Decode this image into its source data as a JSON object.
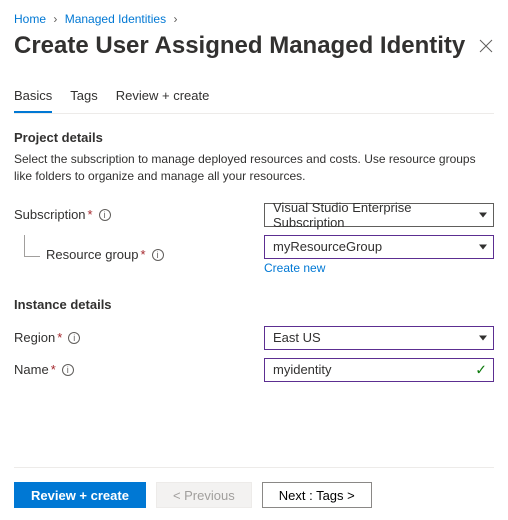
{
  "breadcrumb": {
    "home": "Home",
    "section": "Managed Identities"
  },
  "title": "Create User Assigned Managed Identity",
  "tabs": {
    "basics": "Basics",
    "tags": "Tags",
    "review": "Review + create"
  },
  "projectDetails": {
    "heading": "Project details",
    "description": "Select the subscription to manage deployed resources and costs. Use resource groups like folders to organize and manage all your resources.",
    "subscriptionLabel": "Subscription",
    "subscriptionValue": "Visual Studio Enterprise Subscription",
    "resourceGroupLabel": "Resource group",
    "resourceGroupValue": "myResourceGroup",
    "createNew": "Create new"
  },
  "instanceDetails": {
    "heading": "Instance details",
    "regionLabel": "Region",
    "regionValue": "East US",
    "nameLabel": "Name",
    "nameValue": "myidentity"
  },
  "footer": {
    "reviewCreate": "Review + create",
    "previous": "< Previous",
    "next": "Next : Tags >"
  }
}
